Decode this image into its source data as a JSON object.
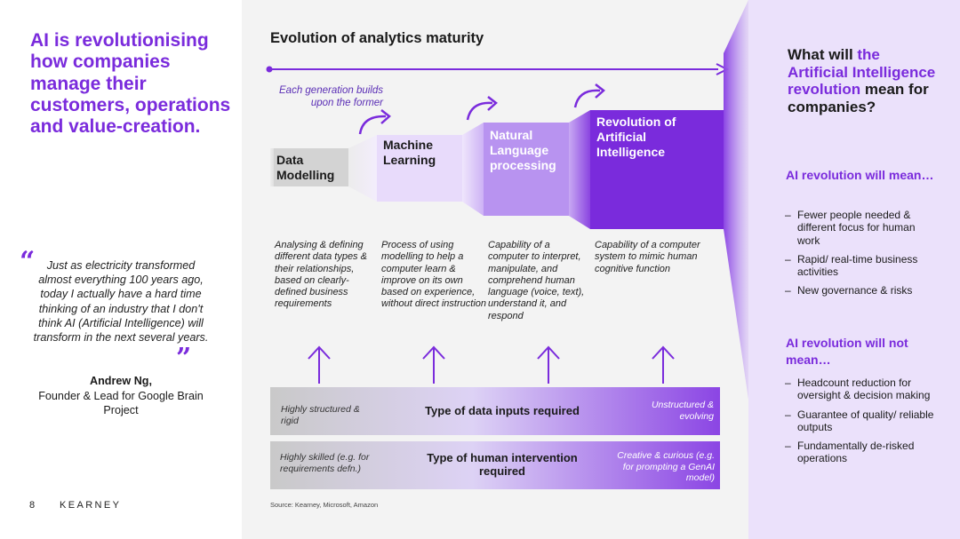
{
  "left": {
    "headline": "AI is revolutionising how companies manage their customers, operations and value-creation.",
    "quote_open": "“",
    "quote_close": "”",
    "quote": "Just as electricity transformed almost everything 100 years ago, today I actually have a hard time thinking of an industry that I don't think AI (Artificial Intelligence) will transform in the next several years.",
    "author_name": "Andrew Ng,",
    "author_role": "Founder & Lead for Google Brain Project",
    "page_number": "8",
    "brand": "KEARNEY"
  },
  "middle": {
    "title": "Evolution of analytics maturity",
    "generation_note": "Each generation builds upon the former",
    "stages": [
      {
        "title": "Data Modelling",
        "description": "Analysing & defining different data types & their relationships, based on clearly-defined business requirements",
        "fill": "#d3d3d3"
      },
      {
        "title": "Machine Learning",
        "description": "Process of using modelling to help a computer learn & improve on its own based on experience, without direct instruction",
        "fill": "#e8dbfb"
      },
      {
        "title": "Natural Language processing",
        "description": "Capability of a computer to interpret, manipulate, and comprehend human language (voice, text), understand it, and respond",
        "fill": "#b893f0"
      },
      {
        "title": "Revolution of Artificial Intelligence",
        "description": "Capability of a computer system to mimic human cognitive function",
        "fill": "#7a2bdc"
      }
    ],
    "data_bar": {
      "left": "Highly structured & rigid",
      "center": "Type of data inputs required",
      "right": "Unstructured & evolving"
    },
    "human_bar": {
      "left": "Highly skilled (e.g. for requirements defn.)",
      "center": "Type of human intervention required",
      "right": "Creative & curious (e.g. for prompting a GenAI model)"
    },
    "source": "Source: Kearney, Microsoft, Amazon"
  },
  "right": {
    "question_part1": "What will ",
    "question_accent": "the Artificial Intelligence revolution",
    "question_part2": " mean for companies?",
    "will_heading": "AI revolution will mean…",
    "will_items": [
      "Fewer people needed & different focus for human work",
      "Rapid/ real-time business activities",
      "New governance & risks"
    ],
    "will_not_heading": "AI revolution will not mean…",
    "will_not_items": [
      "Headcount reduction for oversight & decision making",
      "Guarantee of quality/ reliable outputs",
      "Fundamentally de-risked operations"
    ],
    "bullet_dash": "–"
  },
  "colors": {
    "accent": "#7a2bdc",
    "panel_gray": "#f3f3f3",
    "panel_lilac": "#ebe1fb"
  }
}
